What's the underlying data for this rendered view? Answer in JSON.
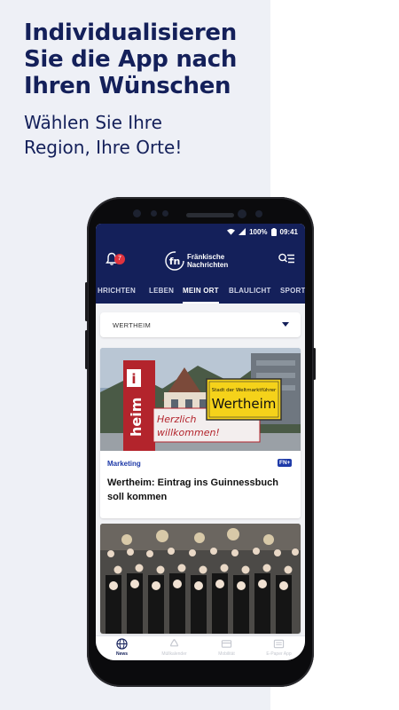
{
  "promo": {
    "headline": [
      "Individualisieren",
      "Sie die App nach",
      "Ihren Wünschen"
    ],
    "subline": [
      "Wählen Sie Ihre",
      "Region, Ihre Orte!"
    ]
  },
  "status": {
    "battery": "100%",
    "time": "09:41"
  },
  "appbar": {
    "notification_count": "7",
    "logo_mark": "fn",
    "logo_lines": [
      "Fränkische",
      "Nachrichten"
    ]
  },
  "tabs": [
    "HRICHTEN",
    "LEBEN",
    "MEIN ORT",
    "BLAULICHT",
    "SPORT"
  ],
  "active_tab": "MEIN ORT",
  "location_select": {
    "value": "WERTHEIM"
  },
  "articles": [
    {
      "category": "Marketing",
      "badge": "FN+",
      "title_lines": [
        "Wertheim: Eintrag ins Guinnessbuch",
        "soll kommen"
      ],
      "image": {
        "sign_top": "Stadt der Weltmarktführer",
        "sign_city": "Wertheim",
        "banner_line1": "Herzlich",
        "banner_line2": "willkommen!",
        "pillar_text": "heim",
        "info_letter": "i"
      }
    },
    {
      "category": "",
      "title_lines": []
    }
  ],
  "bottom_nav": [
    {
      "label": "News",
      "icon": "globe-icon",
      "active": true
    },
    {
      "label": "Müllkalender",
      "icon": "recycle-icon",
      "active": false
    },
    {
      "label": "Mobilität",
      "icon": "card-icon",
      "active": false
    },
    {
      "label": "E-Paper App",
      "icon": "epaper-icon",
      "active": false
    }
  ],
  "colors": {
    "brand": "#14205a",
    "accent": "#1e3aa8",
    "badge": "#e0333e"
  }
}
